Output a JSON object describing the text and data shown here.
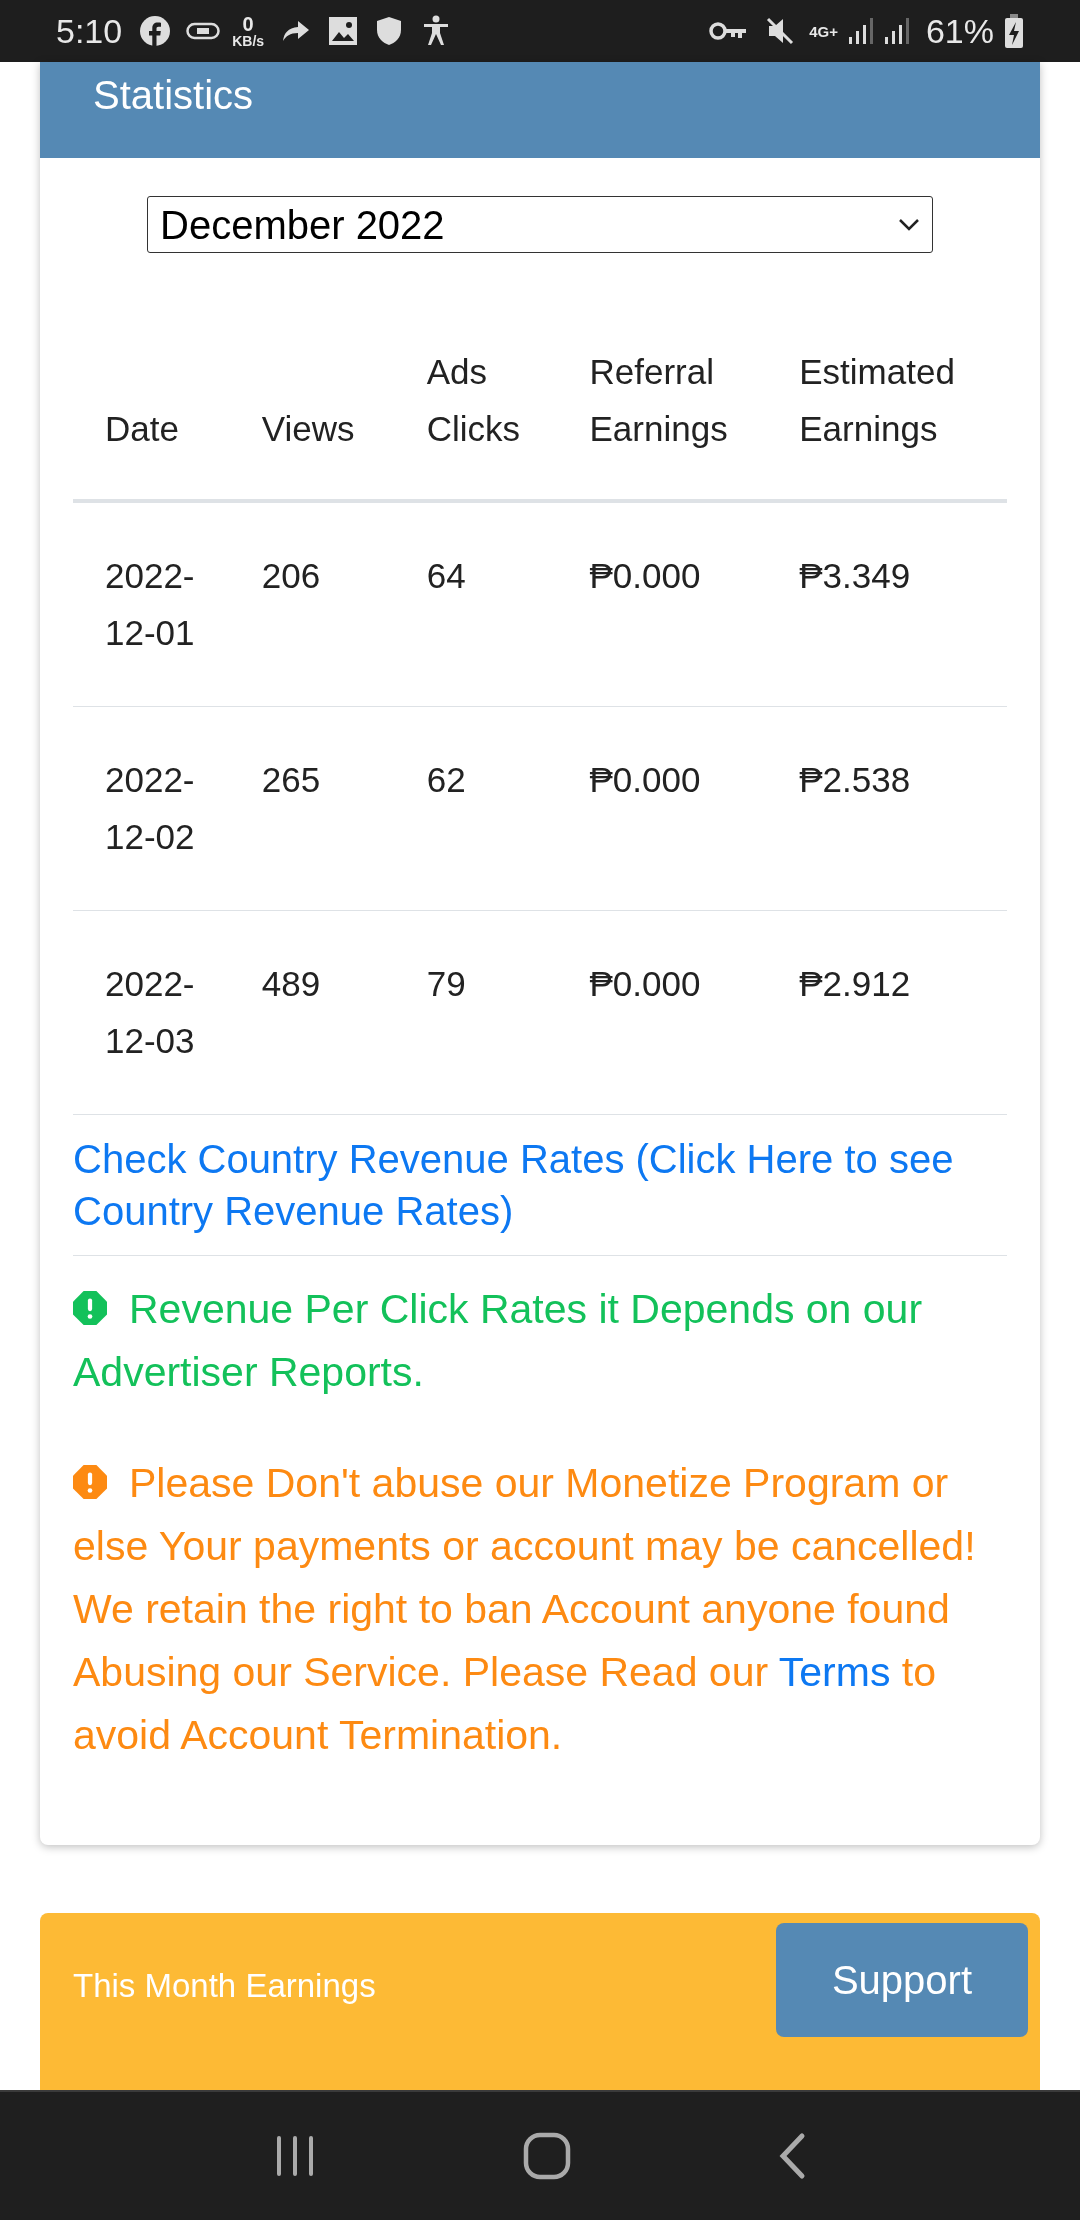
{
  "status_bar": {
    "time": "5:10",
    "speed_value": "0",
    "speed_unit": "KB/s",
    "network": "4G+",
    "battery": "61%"
  },
  "statistics": {
    "title": "Statistics",
    "month_select": {
      "value": "December 2022"
    },
    "table": {
      "columns": [
        [
          "Date"
        ],
        [
          "Views"
        ],
        [
          "Ads",
          "Clicks"
        ],
        [
          "Referral",
          "Earnings"
        ],
        [
          "Estimated",
          "Earnings"
        ]
      ],
      "rows": [
        {
          "date": [
            "2022-",
            "12-01"
          ],
          "views": "206",
          "ads_clicks": "64",
          "referral": "₱0.000",
          "estimated": "₱3.349"
        },
        {
          "date": [
            "2022-",
            "12-02"
          ],
          "views": "265",
          "ads_clicks": "62",
          "referral": "₱0.000",
          "estimated": "₱2.538"
        },
        {
          "date": [
            "2022-",
            "12-03"
          ],
          "views": "489",
          "ads_clicks": "79",
          "referral": "₱0.000",
          "estimated": "₱2.912"
        }
      ]
    },
    "rates_link": "Check Country Revenue Rates (Click Here to see Country Revenue Rates)",
    "notices": [
      {
        "color": "#13c15a",
        "text": "Revenue Per Click Rates it Depends on our Advertiser Reports."
      },
      {
        "color": "#fd8a12",
        "text": "Please Don't abuse our Monetize Program or else Your payments or account may be cancelled! We retain the right to ban Account anyone found Abusing our Service. Please Read our ",
        "link": "Terms",
        "after": " to avoid Account Termination."
      }
    ]
  },
  "earnings_card": {
    "label": "This Month Earnings",
    "button": "Support"
  }
}
